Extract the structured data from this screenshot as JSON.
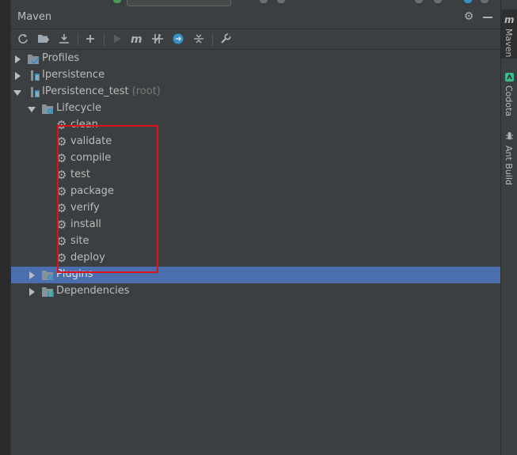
{
  "panel": {
    "title": "Maven"
  },
  "toolbar": {
    "buttons": [
      {
        "name": "reload-icon"
      },
      {
        "name": "add-maven-project-icon"
      },
      {
        "name": "download-sources-icon"
      },
      {
        "name": "add-icon"
      },
      {
        "name": "run-icon"
      },
      {
        "name": "execute-maven-goal-icon"
      },
      {
        "name": "toggle-offline-icon"
      },
      {
        "name": "skip-tests-icon"
      },
      {
        "name": "collapse-all-icon"
      },
      {
        "name": "settings-wrench-icon"
      }
    ]
  },
  "tree": {
    "profiles": "Profiles",
    "ipersistence": "Ipersistence",
    "ipersistence_test": "IPersistence_test",
    "root_suffix": "(root)",
    "lifecycle": "Lifecycle",
    "phases": [
      "clean",
      "validate",
      "compile",
      "test",
      "package",
      "verify",
      "install",
      "site",
      "deploy"
    ],
    "plugins": "Plugins",
    "dependencies": "Dependencies"
  },
  "right_sidebar": {
    "tabs": [
      {
        "label": "Maven",
        "icon": "maven-m-icon"
      },
      {
        "label": "Codota",
        "icon": "codota-icon"
      },
      {
        "label": "Ant Build",
        "icon": "ant-icon"
      }
    ]
  },
  "colors": {
    "selection": "#4b6eaf",
    "highlight_box": "#e0101a",
    "panel_bg": "#3c3f41",
    "accent_blue": "#3592c4",
    "codota_green": "#3dbb8c"
  }
}
